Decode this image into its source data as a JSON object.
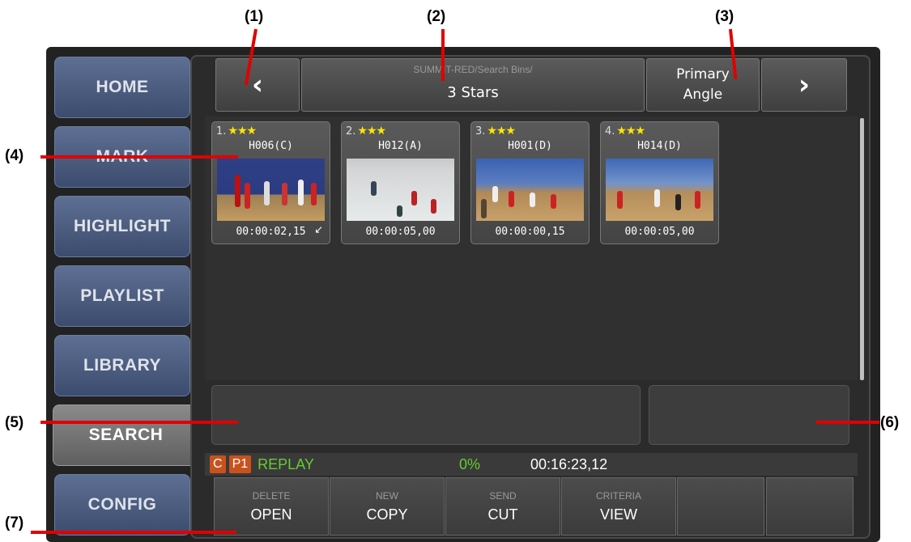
{
  "sidebar": {
    "tabs": [
      {
        "label": "HOME"
      },
      {
        "label": "MARK"
      },
      {
        "label": "HIGHLIGHT"
      },
      {
        "label": "PLAYLIST"
      },
      {
        "label": "LIBRARY"
      },
      {
        "label": "SEARCH",
        "active": true
      },
      {
        "label": "CONFIG"
      }
    ]
  },
  "header": {
    "prev_icon": "chevron-left-icon",
    "next_icon": "chevron-right-icon",
    "path": "SUMMIT-RED/Search Bins/",
    "title": "3 Stars",
    "angle_line1": "Primary",
    "angle_line2": "Angle"
  },
  "clips": [
    {
      "number": "1.",
      "stars": "★★★",
      "name": "H006(C)",
      "timecode": "00:00:02,15",
      "marker_icon": "arrow-down-left-icon"
    },
    {
      "number": "2.",
      "stars": "★★★",
      "name": "H012(A)",
      "timecode": "00:00:05,00"
    },
    {
      "number": "3.",
      "stars": "★★★",
      "name": "H001(D)",
      "timecode": "00:00:00,15"
    },
    {
      "number": "4.",
      "stars": "★★★",
      "name": "H014(D)",
      "timecode": "00:00:05,00"
    }
  ],
  "status": {
    "channel": "C",
    "player": "P1",
    "mode": "REPLAY",
    "percent": "0%",
    "timecode": "00:16:23,12",
    "mode_color": "#66cc33",
    "percent_color": "#66cc33"
  },
  "bottom_buttons": [
    {
      "top": "DELETE",
      "main": "OPEN"
    },
    {
      "top": "NEW",
      "main": "COPY"
    },
    {
      "top": "SEND",
      "main": "CUT"
    },
    {
      "top": "CRITERIA",
      "main": "VIEW"
    },
    {
      "top": "",
      "main": ""
    },
    {
      "top": "",
      "main": ""
    }
  ],
  "callouts": [
    "(1)",
    "(2)",
    "(3)",
    "(4)",
    "(5)",
    "(6)",
    "(7)"
  ],
  "colors": {
    "star": "#ffe600",
    "badge": "#c8521e",
    "tab_blue": "#4a5b80",
    "callout_line": "#e00000"
  }
}
